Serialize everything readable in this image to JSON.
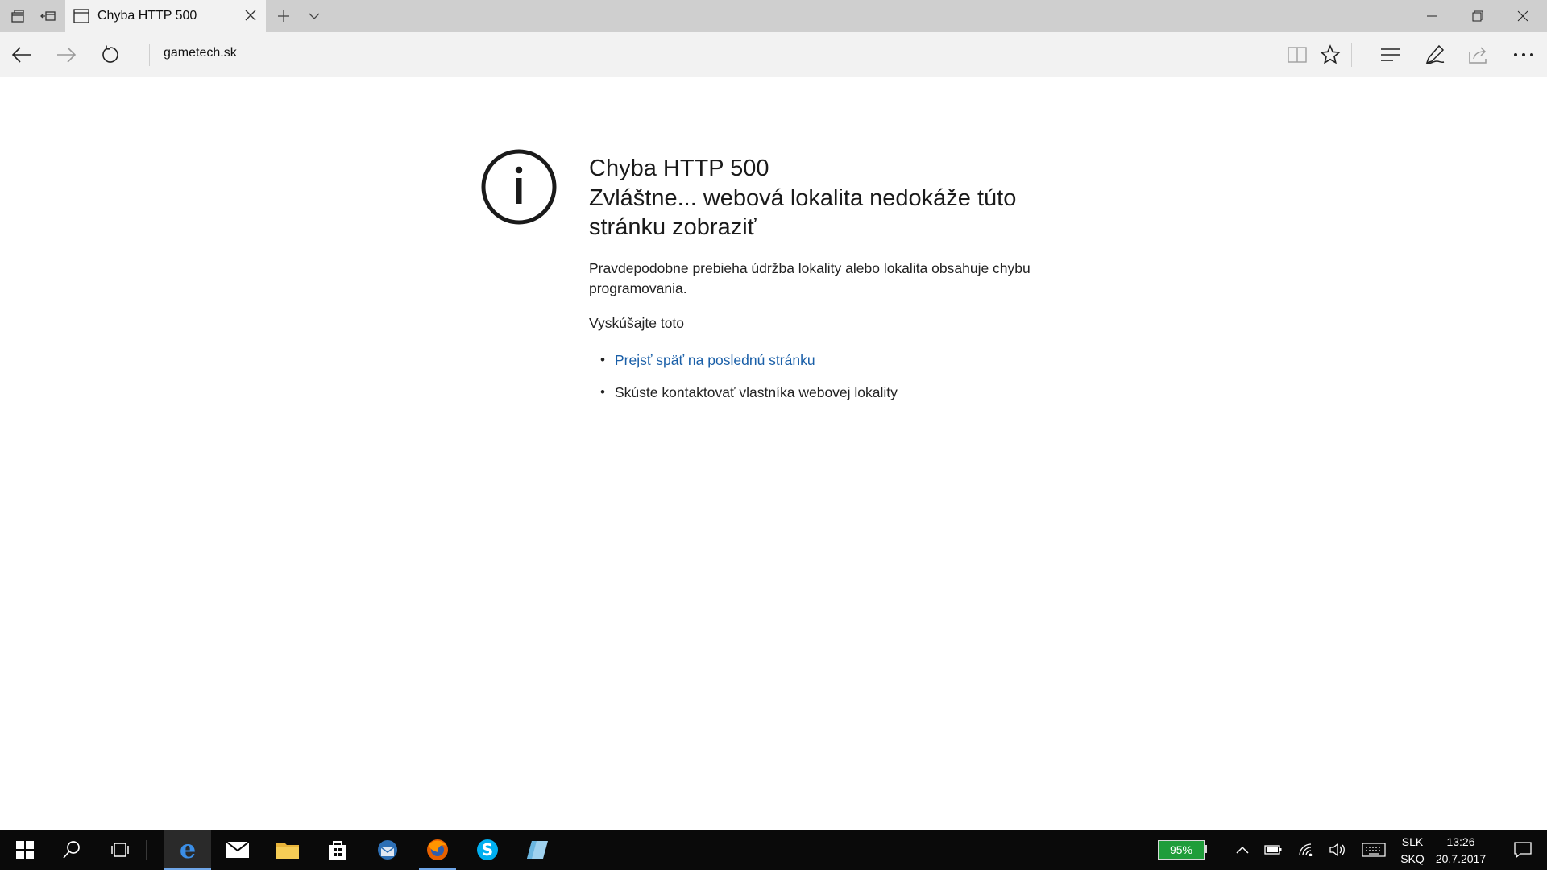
{
  "browser": {
    "tab": {
      "title": "Chyba HTTP 500"
    },
    "address": {
      "url": "gametech.sk"
    }
  },
  "error": {
    "title": "Chyba HTTP 500",
    "subtitle_line1": "Zvláštne... webová lokalita nedokáže túto",
    "subtitle_line2": "stránku zobraziť",
    "description_line1": "Pravdepodobne prebieha údržba lokality alebo lokalita obsahuje chybu",
    "description_line2": "programovania.",
    "try_heading": "Vyskúšajte toto",
    "suggestions": [
      {
        "text": "Prejsť späť na poslednú stránku"
      },
      {
        "text": "Skúste kontaktovať vlastníka webovej lokality"
      }
    ]
  },
  "taskbar": {
    "battery": "95%",
    "lang_line1": "SLK",
    "lang_line2": "SKQ",
    "time": "13:26",
    "date": "20.7.2017"
  },
  "colors": {
    "link": "#1a5fa8",
    "battery": "#1f9d3a",
    "taskbar": "#0a0a0a",
    "active_underline": "#6fa6e8"
  }
}
